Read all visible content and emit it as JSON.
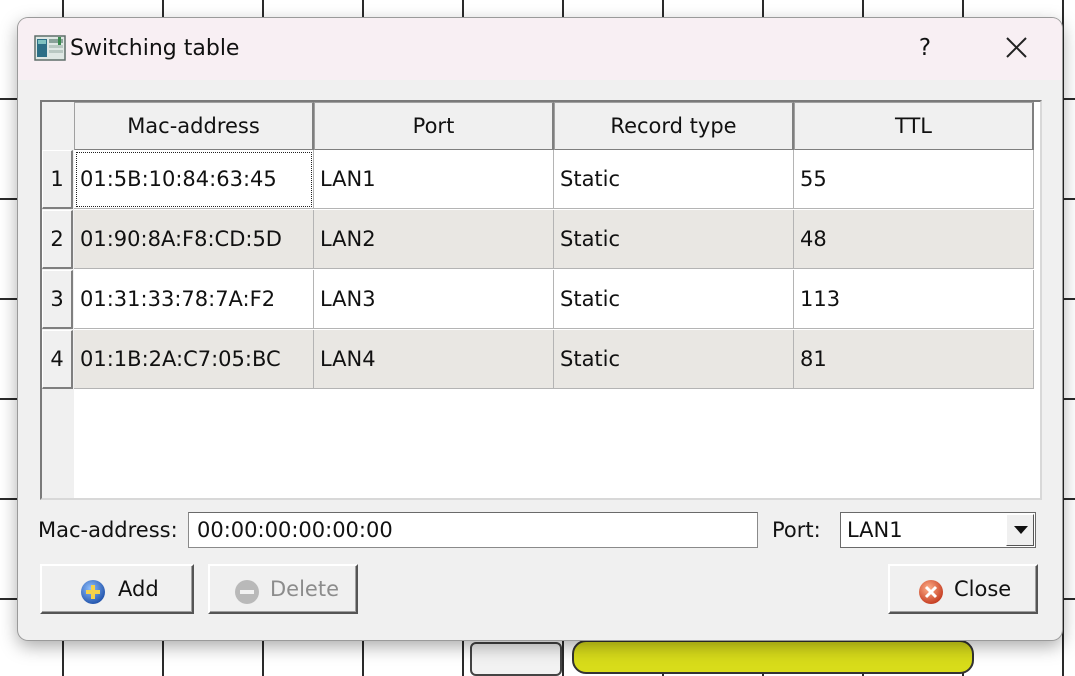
{
  "window": {
    "title": "Switching table",
    "help_label": "?"
  },
  "table": {
    "columns": [
      "Mac-address",
      "Port",
      "Record type",
      "TTL"
    ],
    "rows": [
      {
        "index": "1",
        "mac": "01:5B:10:84:63:45",
        "port": "LAN1",
        "type": "Static",
        "ttl": "55"
      },
      {
        "index": "2",
        "mac": "01:90:8A:F8:CD:5D",
        "port": "LAN2",
        "type": "Static",
        "ttl": "48"
      },
      {
        "index": "3",
        "mac": "01:31:33:78:7A:F2",
        "port": "LAN3",
        "type": "Static",
        "ttl": "113"
      },
      {
        "index": "4",
        "mac": "01:1B:2A:C7:05:BC",
        "port": "LAN4",
        "type": "Static",
        "ttl": "81"
      }
    ]
  },
  "form": {
    "mac_label": "Mac-address:",
    "mac_value": "00:00:00:00:00:00",
    "port_label": "Port:",
    "port_value": "LAN1"
  },
  "buttons": {
    "add": "Add",
    "delete": "Delete",
    "close": "Close"
  },
  "colors": {
    "title_bar": "#f8eff3",
    "dialog_bg": "#f0f0f0",
    "alt_row": "#e9e7e3",
    "add_icon": "#2f6ccf",
    "close_icon": "#d94a2a"
  },
  "icons": {
    "app": "switching-table-app-icon",
    "add": "plus-circle-icon",
    "delete": "minus-circle-icon",
    "close": "x-circle-icon",
    "dropdown": "chevron-down-icon"
  }
}
